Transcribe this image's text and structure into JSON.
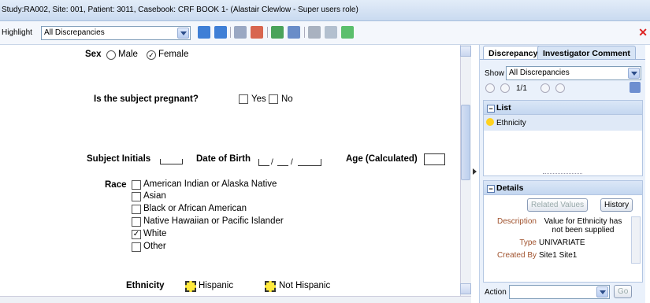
{
  "header": {
    "title": "Study:RA002, Site: 001, Patient: 3011, Casebook: CRF BOOK 1- (Alastair Clewlow - Super users role)"
  },
  "toolbar": {
    "highlight_label": "Highlight",
    "highlight_value": "All Discrepancies",
    "close_icon": "close-icon"
  },
  "form": {
    "sex_label": "Sex",
    "sex_male": "Male",
    "sex_female": "Female",
    "sex_selected": "Female",
    "pregnant_label": "Is the subject pregnant?",
    "pregnant_yes": "Yes",
    "pregnant_no": "No",
    "initials_label": "Subject Initials",
    "dob_label": "Date of Birth",
    "age_label": "Age (Calculated)",
    "race_label": "Race",
    "race_options": [
      "American Indian or Alaska Native",
      "Asian",
      "Black or African American",
      "Native Hawaiian or Pacific Islander",
      "White",
      "Other"
    ],
    "race_checked": "White",
    "ethnicity_label": "Ethnicity",
    "ethnicity_hispanic": "Hispanic",
    "ethnicity_not_hispanic": "Not Hispanic"
  },
  "panel": {
    "tabs": [
      "Discrepancy",
      "Investigator Comment"
    ],
    "show_label": "Show",
    "show_value": "All Discrepancies",
    "pager": "1/1",
    "list_title": "List",
    "list_items": [
      "Ethnicity"
    ],
    "details_title": "Details",
    "related_values_button": "Related Values",
    "history_button": "History",
    "description_label": "Description",
    "description_value": "Value for Ethnicity has not been supplied",
    "type_label": "Type",
    "type_value": "UNIVARIATE",
    "created_by_label": "Created By",
    "created_by_value": "Site1 Site1",
    "action_label": "Action",
    "action_value": "",
    "go_button": "Go"
  },
  "colors": {
    "accent": "#c9daf0",
    "status_dot": "#ffd21f",
    "highlight_box": "#ffe93d"
  }
}
